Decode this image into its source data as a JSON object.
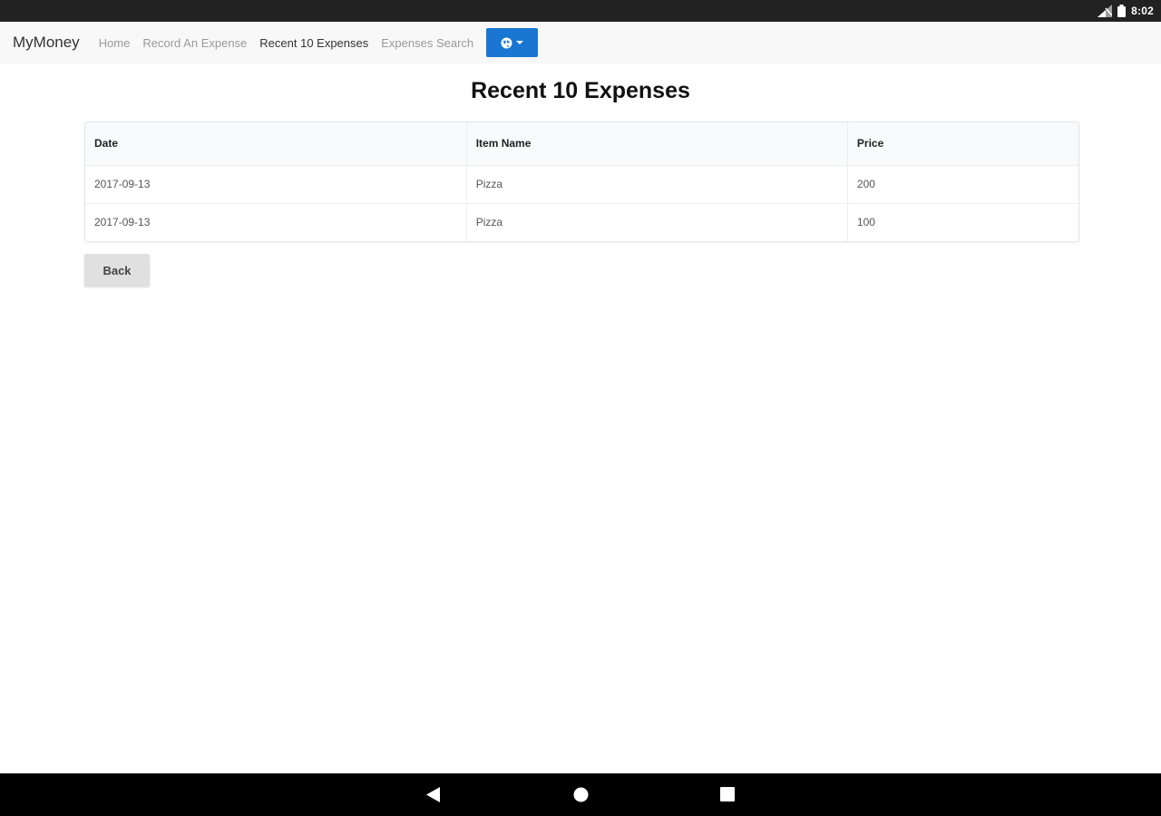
{
  "status_bar": {
    "time": "8:02"
  },
  "navbar": {
    "brand": "MyMoney",
    "links": [
      {
        "label": "Home",
        "active": false
      },
      {
        "label": "Record An Expense",
        "active": false
      },
      {
        "label": "Recent 10 Expenses",
        "active": true
      },
      {
        "label": "Expenses Search",
        "active": false
      }
    ],
    "dropdown_icon": "globe-icon",
    "accent": "#1976d2"
  },
  "page": {
    "title": "Recent 10 Expenses",
    "table": {
      "headers": [
        "Date",
        "Item Name",
        "Price"
      ],
      "rows": [
        [
          "2017-09-13",
          "Pizza",
          "200"
        ],
        [
          "2017-09-13",
          "Pizza",
          "100"
        ]
      ]
    },
    "back_label": "Back"
  },
  "system_nav": {
    "icons": [
      "back-icon",
      "home-icon",
      "recents-icon"
    ]
  }
}
